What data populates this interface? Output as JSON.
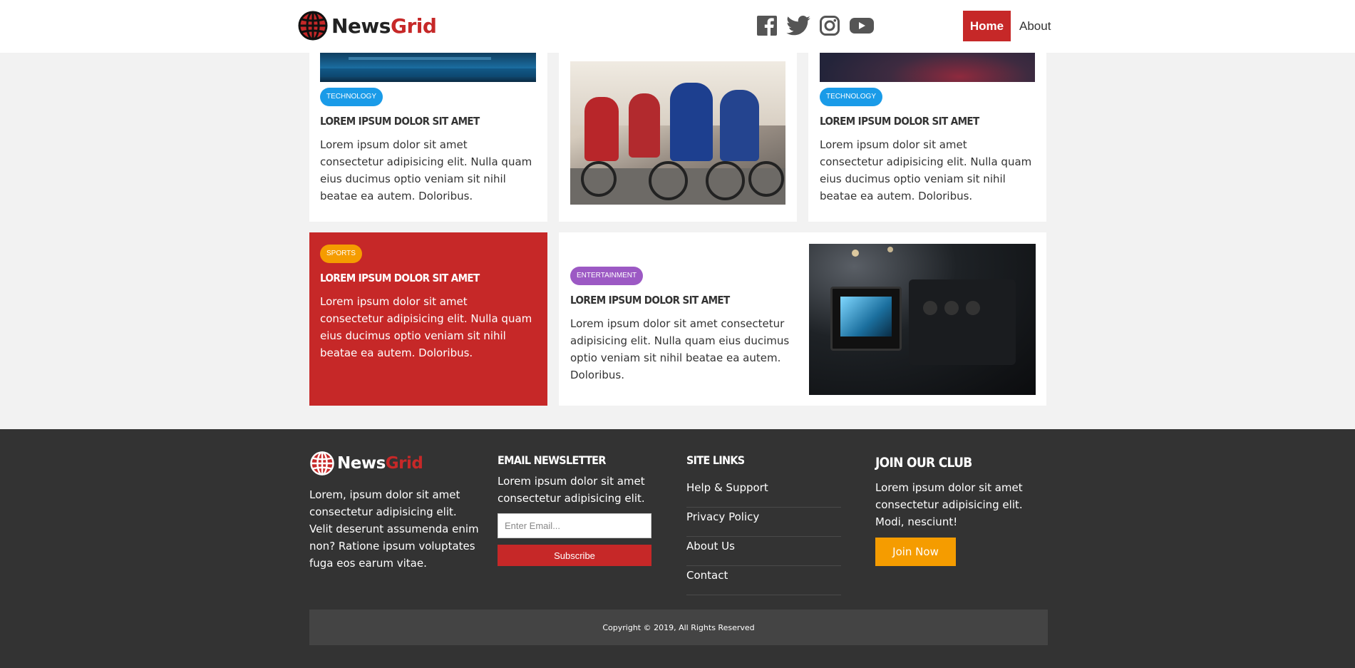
{
  "header": {
    "logo_news": "News",
    "logo_grid": "Grid",
    "social": [
      "facebook-icon",
      "twitter-icon",
      "instagram-icon",
      "youtube-icon"
    ],
    "nav": {
      "home": "Home",
      "about": "About"
    }
  },
  "colors": {
    "brand_red": "#c62828",
    "tech_blue": "#1a9be8",
    "sports_orange": "#f59c00",
    "entertainment_purple": "#9c59c4",
    "footer_dark": "#333333"
  },
  "cards": {
    "tech1": {
      "category": "Technology",
      "title": "Lorem ipsum dolor sit amet",
      "text": "Lorem ipsum dolor sit amet consectetur adipisicing elit. Nulla quam eius ducimus optio veniam sit nihil beatae ea autem. Doloribus."
    },
    "tech2": {
      "category": "Technology",
      "title": "Lorem ipsum dolor sit amet",
      "text": "Lorem ipsum dolor sit amet consectetur adipisicing elit. Nulla quam eius ducimus optio veniam sit nihil beatae ea autem. Doloribus."
    },
    "sports": {
      "category": "Sports",
      "title": "Lorem ipsum dolor sit amet",
      "text": "Lorem ipsum dolor sit amet consectetur adipisicing elit. Nulla quam eius ducimus optio veniam sit nihil beatae ea autem. Doloribus."
    },
    "entertainment": {
      "category": "Entertainment",
      "title": "Lorem ipsum dolor sit amet",
      "text": "Lorem ipsum dolor sit amet consectetur adipisicing elit. Nulla quam eius ducimus optio veniam sit nihil beatae ea autem. Doloribus."
    }
  },
  "footer": {
    "logo_news": "News",
    "logo_grid": "Grid",
    "about": "Lorem, ipsum dolor sit amet consectetur adipisicing elit. Velit deserunt assumenda enim non? Ratione ipsum voluptates fuga eos earum vitae.",
    "newsletter": {
      "heading": "Email Newsletter",
      "text": "Lorem ipsum dolor sit amet consectetur adipisicing elit.",
      "placeholder": "Enter Email...",
      "button": "Subscribe"
    },
    "site_links": {
      "heading": "Site Links",
      "items": [
        "Help & Support",
        "Privacy Policy",
        "About Us",
        "Contact"
      ]
    },
    "club": {
      "heading": "Join Our Club",
      "text": "Lorem ipsum dolor sit amet consectetur adipisicing elit. Modi, nesciunt!",
      "button": "Join Now"
    },
    "copyright": "Copyright © 2019, All Rights Reserved"
  }
}
